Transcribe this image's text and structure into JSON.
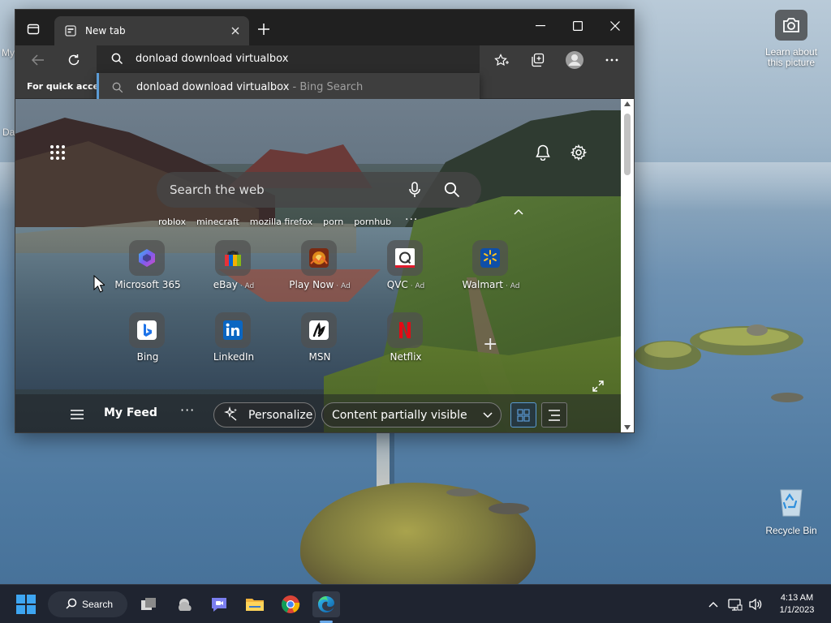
{
  "desktop": {
    "frag_top": "My",
    "frag_mid": "Da",
    "learn_label": "Learn about this picture",
    "recycle_label": "Recycle Bin"
  },
  "browser": {
    "tab_title": "New tab",
    "favorites_bar_text": "For quick access",
    "omnibox_text": "donload download virtualbox",
    "suggestion": {
      "query": "donload download virtualbox",
      "separator": " - ",
      "source": "Bing Search"
    },
    "newtab": {
      "search_placeholder": "Search the web",
      "trending": [
        "roblox",
        "minecraft",
        "mozilla firefox",
        "porn",
        "pornhub"
      ],
      "more_glyph": "···",
      "ad_label": "Ad",
      "tiles": [
        {
          "label": "Microsoft 365",
          "ad": false,
          "icon": "microsoft-365-icon"
        },
        {
          "label": "eBay",
          "ad": true,
          "icon": "ebay-icon"
        },
        {
          "label": "Play Now",
          "ad": true,
          "icon": "play-now-icon"
        },
        {
          "label": "QVC",
          "ad": true,
          "icon": "qvc-icon"
        },
        {
          "label": "Walmart",
          "ad": true,
          "icon": "walmart-icon"
        },
        {
          "label": "Bing",
          "ad": false,
          "icon": "bing-icon"
        },
        {
          "label": "LinkedIn",
          "ad": false,
          "icon": "linkedin-icon"
        },
        {
          "label": "MSN",
          "ad": false,
          "icon": "msn-icon"
        },
        {
          "label": "Netflix",
          "ad": false,
          "icon": "netflix-icon"
        }
      ],
      "feed": {
        "title": "My Feed",
        "more_glyph": "···",
        "personalize": "Personalize",
        "visibility": "Content partially visible"
      }
    }
  },
  "taskbar": {
    "search_label": "Search",
    "time": "4:13 AM",
    "date": "1/1/2023",
    "apps": [
      "task-view",
      "widgets",
      "chat",
      "file-explorer",
      "chrome",
      "edge"
    ]
  },
  "colors": {
    "accent": "#5b9bd5",
    "taskbar": "#1f2430",
    "browser_frame": "#202020",
    "toolbar": "#3b3b3b"
  }
}
